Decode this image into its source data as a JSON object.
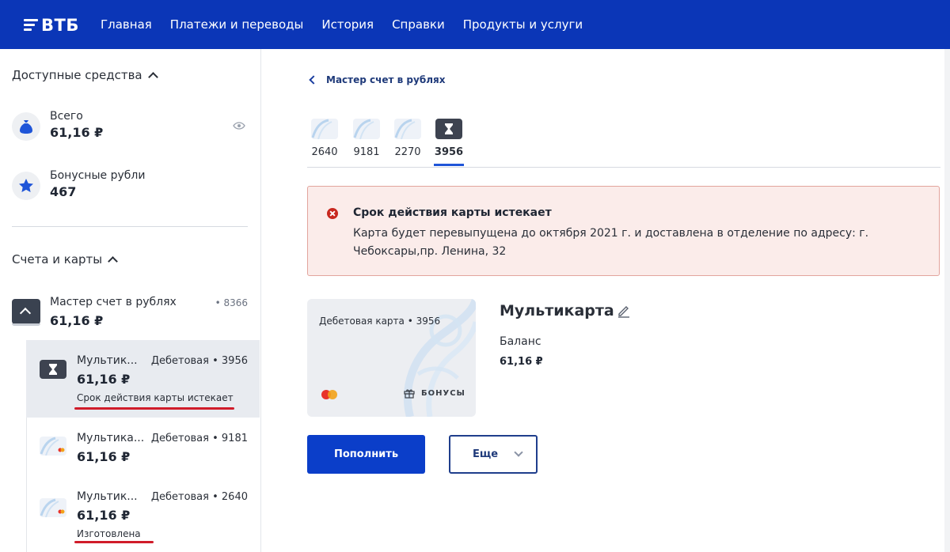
{
  "header": {
    "logo": "ВТБ",
    "nav": [
      "Главная",
      "Платежи и переводы",
      "История",
      "Справки",
      "Продукты и услуги"
    ],
    "brand_color": "#0b36b7"
  },
  "sidebar": {
    "funds": {
      "title": "Доступные средства",
      "total_label": "Всего",
      "total_value": "61,16 ₽",
      "bonus_label": "Бонусные рубли",
      "bonus_value": "467"
    },
    "accounts": {
      "title": "Счета и карты",
      "account": {
        "name": "Мастер счет в рублях",
        "number": "• 8366",
        "value": "61,16 ₽"
      },
      "cards": [
        {
          "name": "Мультик...",
          "type": "Дебетовая • 3956",
          "value": "61,16 ₽",
          "status": "Срок действия карты истекает"
        },
        {
          "name": "Мультика...",
          "type": "Дебетовая • 9181",
          "value": "61,16 ₽",
          "status": ""
        },
        {
          "name": "Мультик...",
          "type": "Дебетовая • 2640",
          "value": "61,16 ₽",
          "status": "Изготовлена"
        }
      ]
    }
  },
  "main": {
    "back_label": "Мастер счет в рублях",
    "tabs": [
      "2640",
      "9181",
      "2270",
      "3956"
    ],
    "active_tab": "3956",
    "alert": {
      "title": "Срок действия карты истекает",
      "text": "Карта будет перевыпущена до октября 2021 г. и доставлена в отделение по адресу: г. Чебоксары,пр. Ленина, 32",
      "color": "#c8281f"
    },
    "card": {
      "type_label": "Дебетовая карта • 3956",
      "bonus_label": "БОНУСЫ",
      "name": "Мультикарта",
      "balance_label": "Баланс",
      "balance_value": "61,16 ₽"
    },
    "actions": {
      "primary": "Пополнить",
      "more": "Еще"
    }
  },
  "icons": [
    "money-bag-icon",
    "star-icon",
    "eye-icon",
    "chevron-up-icon",
    "hourglass-icon",
    "back-arrow-icon",
    "error-icon",
    "mastercard-icon",
    "gift-icon",
    "edit-pencil-icon",
    "chevron-down-icon"
  ]
}
